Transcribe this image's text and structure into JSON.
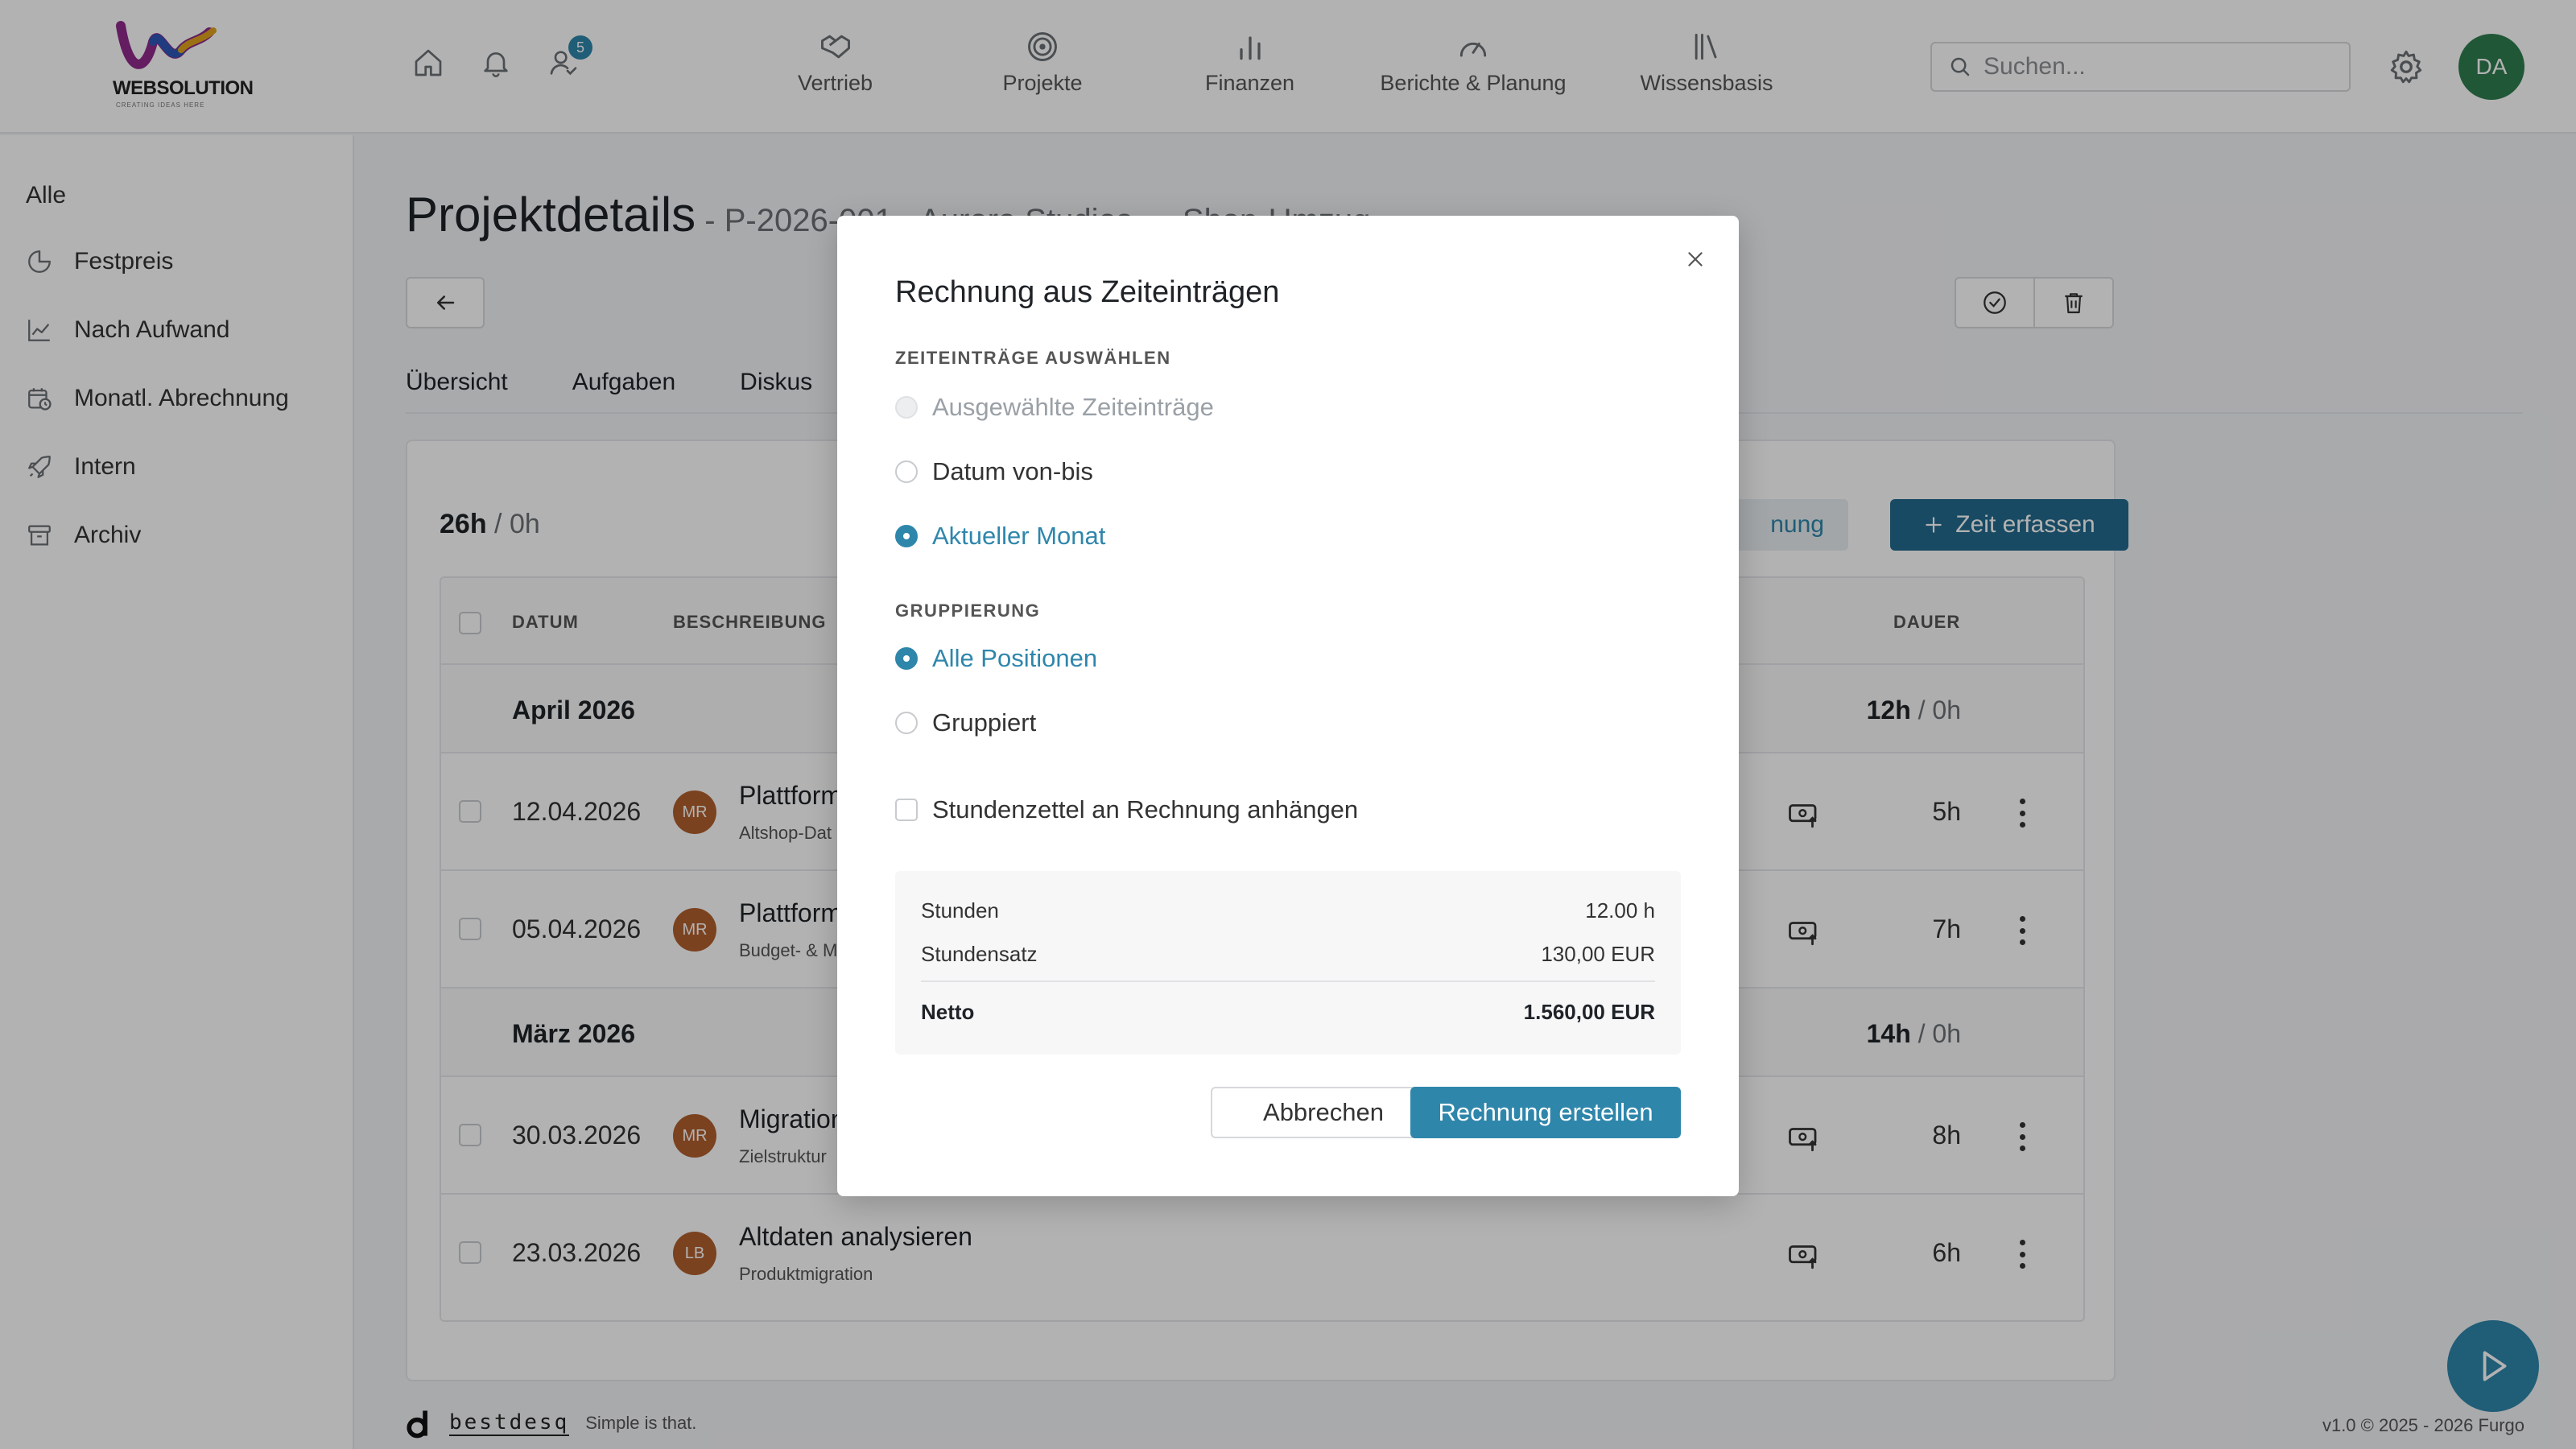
{
  "header": {
    "logo": {
      "brand_prefix": "WEB",
      "brand_suffix": "SOLUTION",
      "claim": "CREATING IDEAS HERE"
    },
    "notification_count": "5",
    "nav": [
      {
        "label": "Vertrieb",
        "icon": "handshake-icon"
      },
      {
        "label": "Projekte",
        "icon": "target-icon"
      },
      {
        "label": "Finanzen",
        "icon": "bar-chart-icon"
      },
      {
        "label": "Berichte & Planung",
        "icon": "gauge-icon"
      },
      {
        "label": "Wissensbasis",
        "icon": "books-icon"
      }
    ],
    "search_placeholder": "Suchen...",
    "avatar_initials": "DA"
  },
  "sidebar": {
    "all_label": "Alle",
    "items": [
      {
        "label": "Festpreis",
        "icon": "pie-chart-icon"
      },
      {
        "label": "Nach Aufwand",
        "icon": "line-chart-icon"
      },
      {
        "label": "Monatl. Abrechnung",
        "icon": "calendar-clock-icon"
      },
      {
        "label": "Intern",
        "icon": "rocket-icon"
      },
      {
        "label": "Archiv",
        "icon": "archive-icon"
      }
    ]
  },
  "page": {
    "title": "Projektdetails",
    "subtitle": " - P-2026-001 · Aurora Studios — Shop-Umzug",
    "tabs": [
      "Übersicht",
      "Aufgaben",
      "Diskus"
    ]
  },
  "timesheet": {
    "hours_total": "26h",
    "hours_separator": " / ",
    "hours_billed": "0h",
    "plan_button": "nung",
    "add_time_button": "Zeit erfassen",
    "columns": {
      "date": "DATUM",
      "description": "BESCHREIBUNG",
      "duration": "DAUER"
    },
    "groups": [
      {
        "label": "April 2026",
        "total": "12h",
        "billed": "0h"
      },
      {
        "label": "März 2026",
        "total": "14h",
        "billed": "0h"
      }
    ],
    "rows": [
      {
        "date": "12.04.2026",
        "initials": "MR",
        "title": "Plattform",
        "sub": "Altshop-Dat",
        "duration": "5h"
      },
      {
        "date": "05.04.2026",
        "initials": "MR",
        "title": "Plattform",
        "sub": "Budget- & M",
        "duration": "7h"
      },
      {
        "date": "30.03.2026",
        "initials": "MR",
        "title": "Migration",
        "sub": "Zielstruktur",
        "duration": "8h"
      },
      {
        "date": "23.03.2026",
        "initials": "LB",
        "title": "Altdaten analysieren",
        "sub": "Produktmigration",
        "duration": "6h"
      }
    ]
  },
  "modal": {
    "title": "Rechnung aus Zeiteinträgen",
    "select_label": "ZEITEINTRÄGE AUSWÄHLEN",
    "select_options": [
      {
        "label": "Ausgewählte Zeiteinträge",
        "state": "disabled"
      },
      {
        "label": "Datum von-bis",
        "state": "unchecked"
      },
      {
        "label": "Aktueller Monat",
        "state": "checked"
      }
    ],
    "grouping_label": "GRUPPIERUNG",
    "grouping_options": [
      {
        "label": "Alle Positionen",
        "state": "checked"
      },
      {
        "label": "Gruppiert",
        "state": "unchecked"
      }
    ],
    "attach_label": "Stundenzettel an Rechnung anhängen",
    "attach_checked": false,
    "summary": {
      "hours_label": "Stunden",
      "hours_value": "12.00 h",
      "rate_label": "Stundensatz",
      "rate_value": "130,00 EUR",
      "net_label": "Netto",
      "net_value": "1.560,00 EUR"
    },
    "cancel_button": "Abbrechen",
    "create_button": "Rechnung erstellen"
  },
  "footer": {
    "wordmark": "bestdesq",
    "tagline": "Simple is that.",
    "version": "v1.0 © 2025 - 2026 Furgo"
  },
  "colors": {
    "accent": "#2f86ab",
    "accent_dark": "#236b8e",
    "avatar_green": "#2f7d4f",
    "avatar_brown": "#b15f2e"
  }
}
